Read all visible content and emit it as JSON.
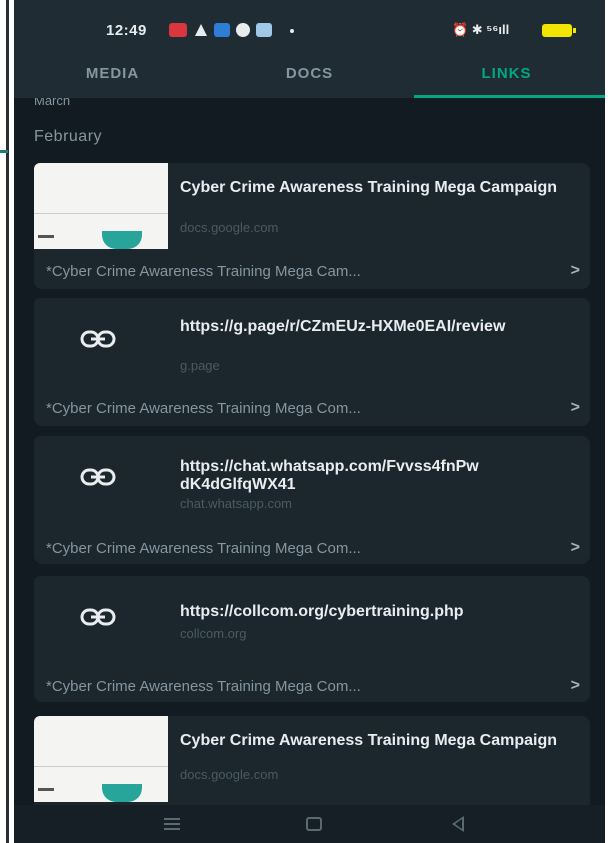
{
  "status_bar": {
    "time": "12:49",
    "right_text": "⏰ ✱ ⁵⁶ıll"
  },
  "tabs": [
    {
      "label": "MEDIA"
    },
    {
      "label": "DOCS"
    },
    {
      "label": "LINKS",
      "active": true
    }
  ],
  "prev_month": "March",
  "section_month": "February",
  "links": [
    {
      "kind": "thumbnail",
      "title": "Cyber Crime Awareness Training Mega Campaign",
      "domain": "docs.google.com",
      "caption": "*Cyber Crime Awareness Training Mega Cam..."
    },
    {
      "kind": "link",
      "title": "https://g.page/r/CZmEUz-HXMe0EAI/review",
      "domain": "g.page",
      "caption": "*Cyber Crime Awareness Training Mega Com..."
    },
    {
      "kind": "link",
      "title": "https://chat.whatsapp.com/Fvvss4fnPwdK4dGlfqWX41",
      "domain": "chat.whatsapp.com",
      "caption": "*Cyber Crime Awareness Training Mega Com..."
    },
    {
      "kind": "link",
      "title": "https://collcom.org/cybertraining.php",
      "domain": "collcom.org",
      "caption": "*Cyber Crime Awareness Training Mega Com..."
    },
    {
      "kind": "thumbnail",
      "title": "Cyber Crime Awareness Training Mega Campaign",
      "domain": "docs.google.com"
    }
  ],
  "colors": {
    "accent": "#00a884",
    "background": "#121b22",
    "header": "#1f2c34"
  }
}
